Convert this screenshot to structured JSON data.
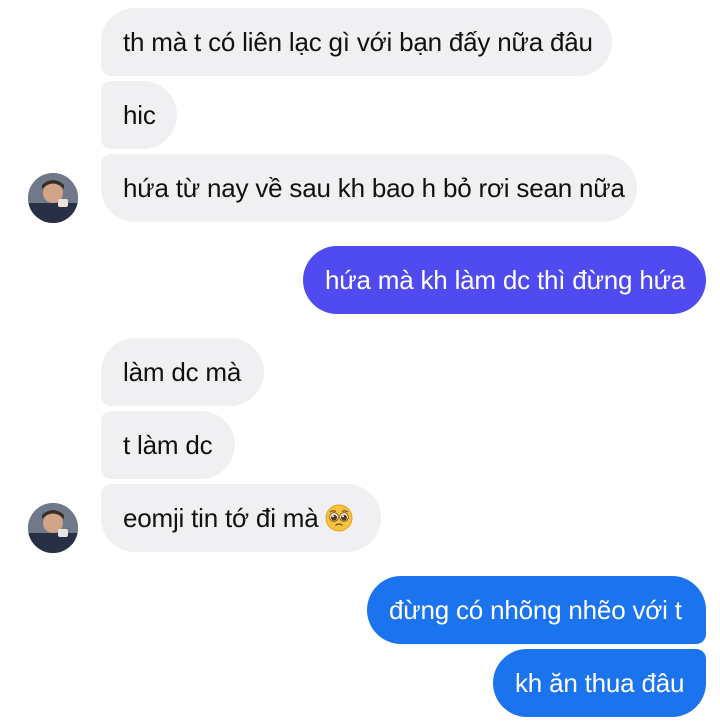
{
  "colors": {
    "incoming_bg": "#f0f0f3",
    "outgoing_purple": "#4f4bf0",
    "outgoing_blue": "#1b74ee"
  },
  "messages": [
    {
      "id": "m1",
      "text": "th mà t có liên lạc gì với bạn đấy nữa đâu"
    },
    {
      "id": "m2",
      "text": "hic"
    },
    {
      "id": "m3",
      "text": "hứa từ nay về sau kh bao h bỏ rơi sean nữa"
    },
    {
      "id": "m4",
      "text": "hứa mà kh làm dc thì đừng hứa"
    },
    {
      "id": "m5",
      "text": "làm dc mà"
    },
    {
      "id": "m6",
      "text": "t làm dc"
    },
    {
      "id": "m7",
      "text": "eomji tin tớ đi mà",
      "emoji": "pleading-face-emoji"
    },
    {
      "id": "m8",
      "text": "đừng có nhõng nhẽo với t"
    },
    {
      "id": "m9",
      "text": "kh ăn thua đâu"
    }
  ]
}
